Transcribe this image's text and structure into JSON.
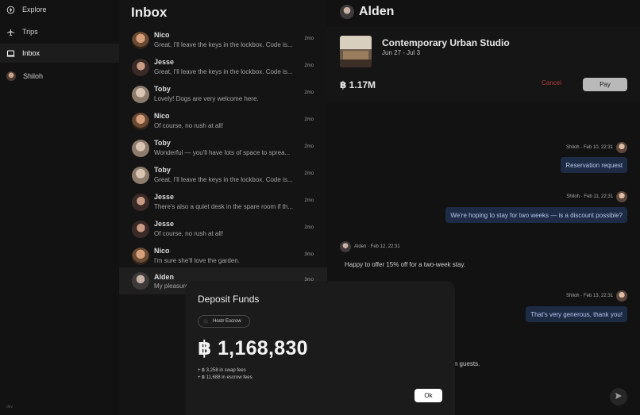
{
  "sidebar": {
    "items": [
      {
        "label": "Explore",
        "icon": "compass-icon"
      },
      {
        "label": "Trips",
        "icon": "plane-icon"
      },
      {
        "label": "Inbox",
        "icon": "laptop-icon"
      },
      {
        "label": "Shiloh",
        "icon": "avatar"
      }
    ],
    "version": "dev"
  },
  "inbox": {
    "title": "Inbox",
    "conversations": [
      {
        "name": "Nico",
        "snippet": "Great, I'll leave the keys in the lockbox. Code is...",
        "time": "2mo"
      },
      {
        "name": "Jesse",
        "snippet": "Great, I'll leave the keys in the lockbox. Code is...",
        "time": "2mo"
      },
      {
        "name": "Toby",
        "snippet": "Lovely! Dogs are very welcome here.",
        "time": "2mo"
      },
      {
        "name": "Nico",
        "snippet": "Of course, no rush at all!",
        "time": "2mo"
      },
      {
        "name": "Toby",
        "snippet": "Wonderful — you'll have lots of space to sprea...",
        "time": "2mo"
      },
      {
        "name": "Toby",
        "snippet": "Great, I'll leave the keys in the lockbox. Code is...",
        "time": "2mo"
      },
      {
        "name": "Jesse",
        "snippet": "There's also a quiet desk in the spare room if th...",
        "time": "2mo"
      },
      {
        "name": "Jesse",
        "snippet": "Of course, no rush at all!",
        "time": "2mo"
      },
      {
        "name": "Nico",
        "snippet": "I'm sure she'll love the garden.",
        "time": "3mo"
      },
      {
        "name": "Alden",
        "snippet": "My pleasure",
        "time": "3mo"
      }
    ]
  },
  "chat": {
    "title": "Alden",
    "listing": {
      "name": "Contemporary Urban Studio",
      "dates": "Jun 27 - Jul 3",
      "price": "฿ 1.17M",
      "cancel_label": "Cancel",
      "pay_label": "Pay"
    },
    "messages": [
      {
        "meta": "Shiloh · Feb 10, 22:31",
        "text": "Reservation request"
      },
      {
        "meta": "Shiloh · Feb 11, 22:31",
        "text": "We're hoping to stay for two weeks — is a discount possible?"
      },
      {
        "meta": "Alden · Feb 12, 22:31",
        "text": "Happy to offer 15% off for a two-week stay."
      },
      {
        "meta": "Shiloh · Feb 13, 22:31",
        "text": "That's very generous, thank you!"
      },
      {
        "meta": "",
        "text": "rm guests."
      }
    ]
  },
  "modal": {
    "title": "Deposit Funds",
    "chip": "Hostr Escrow",
    "amount": "฿ 1,168,830",
    "fees": [
      "+ ฿ 3,258 in swap fees",
      "+ ฿ 11,688 in escrow fees"
    ],
    "ok_label": "Ok"
  },
  "colors": {
    "background": "#121212",
    "bubble": "#1e2b45",
    "cancel": "#b23a3a",
    "pay": "#b9b9b9"
  }
}
